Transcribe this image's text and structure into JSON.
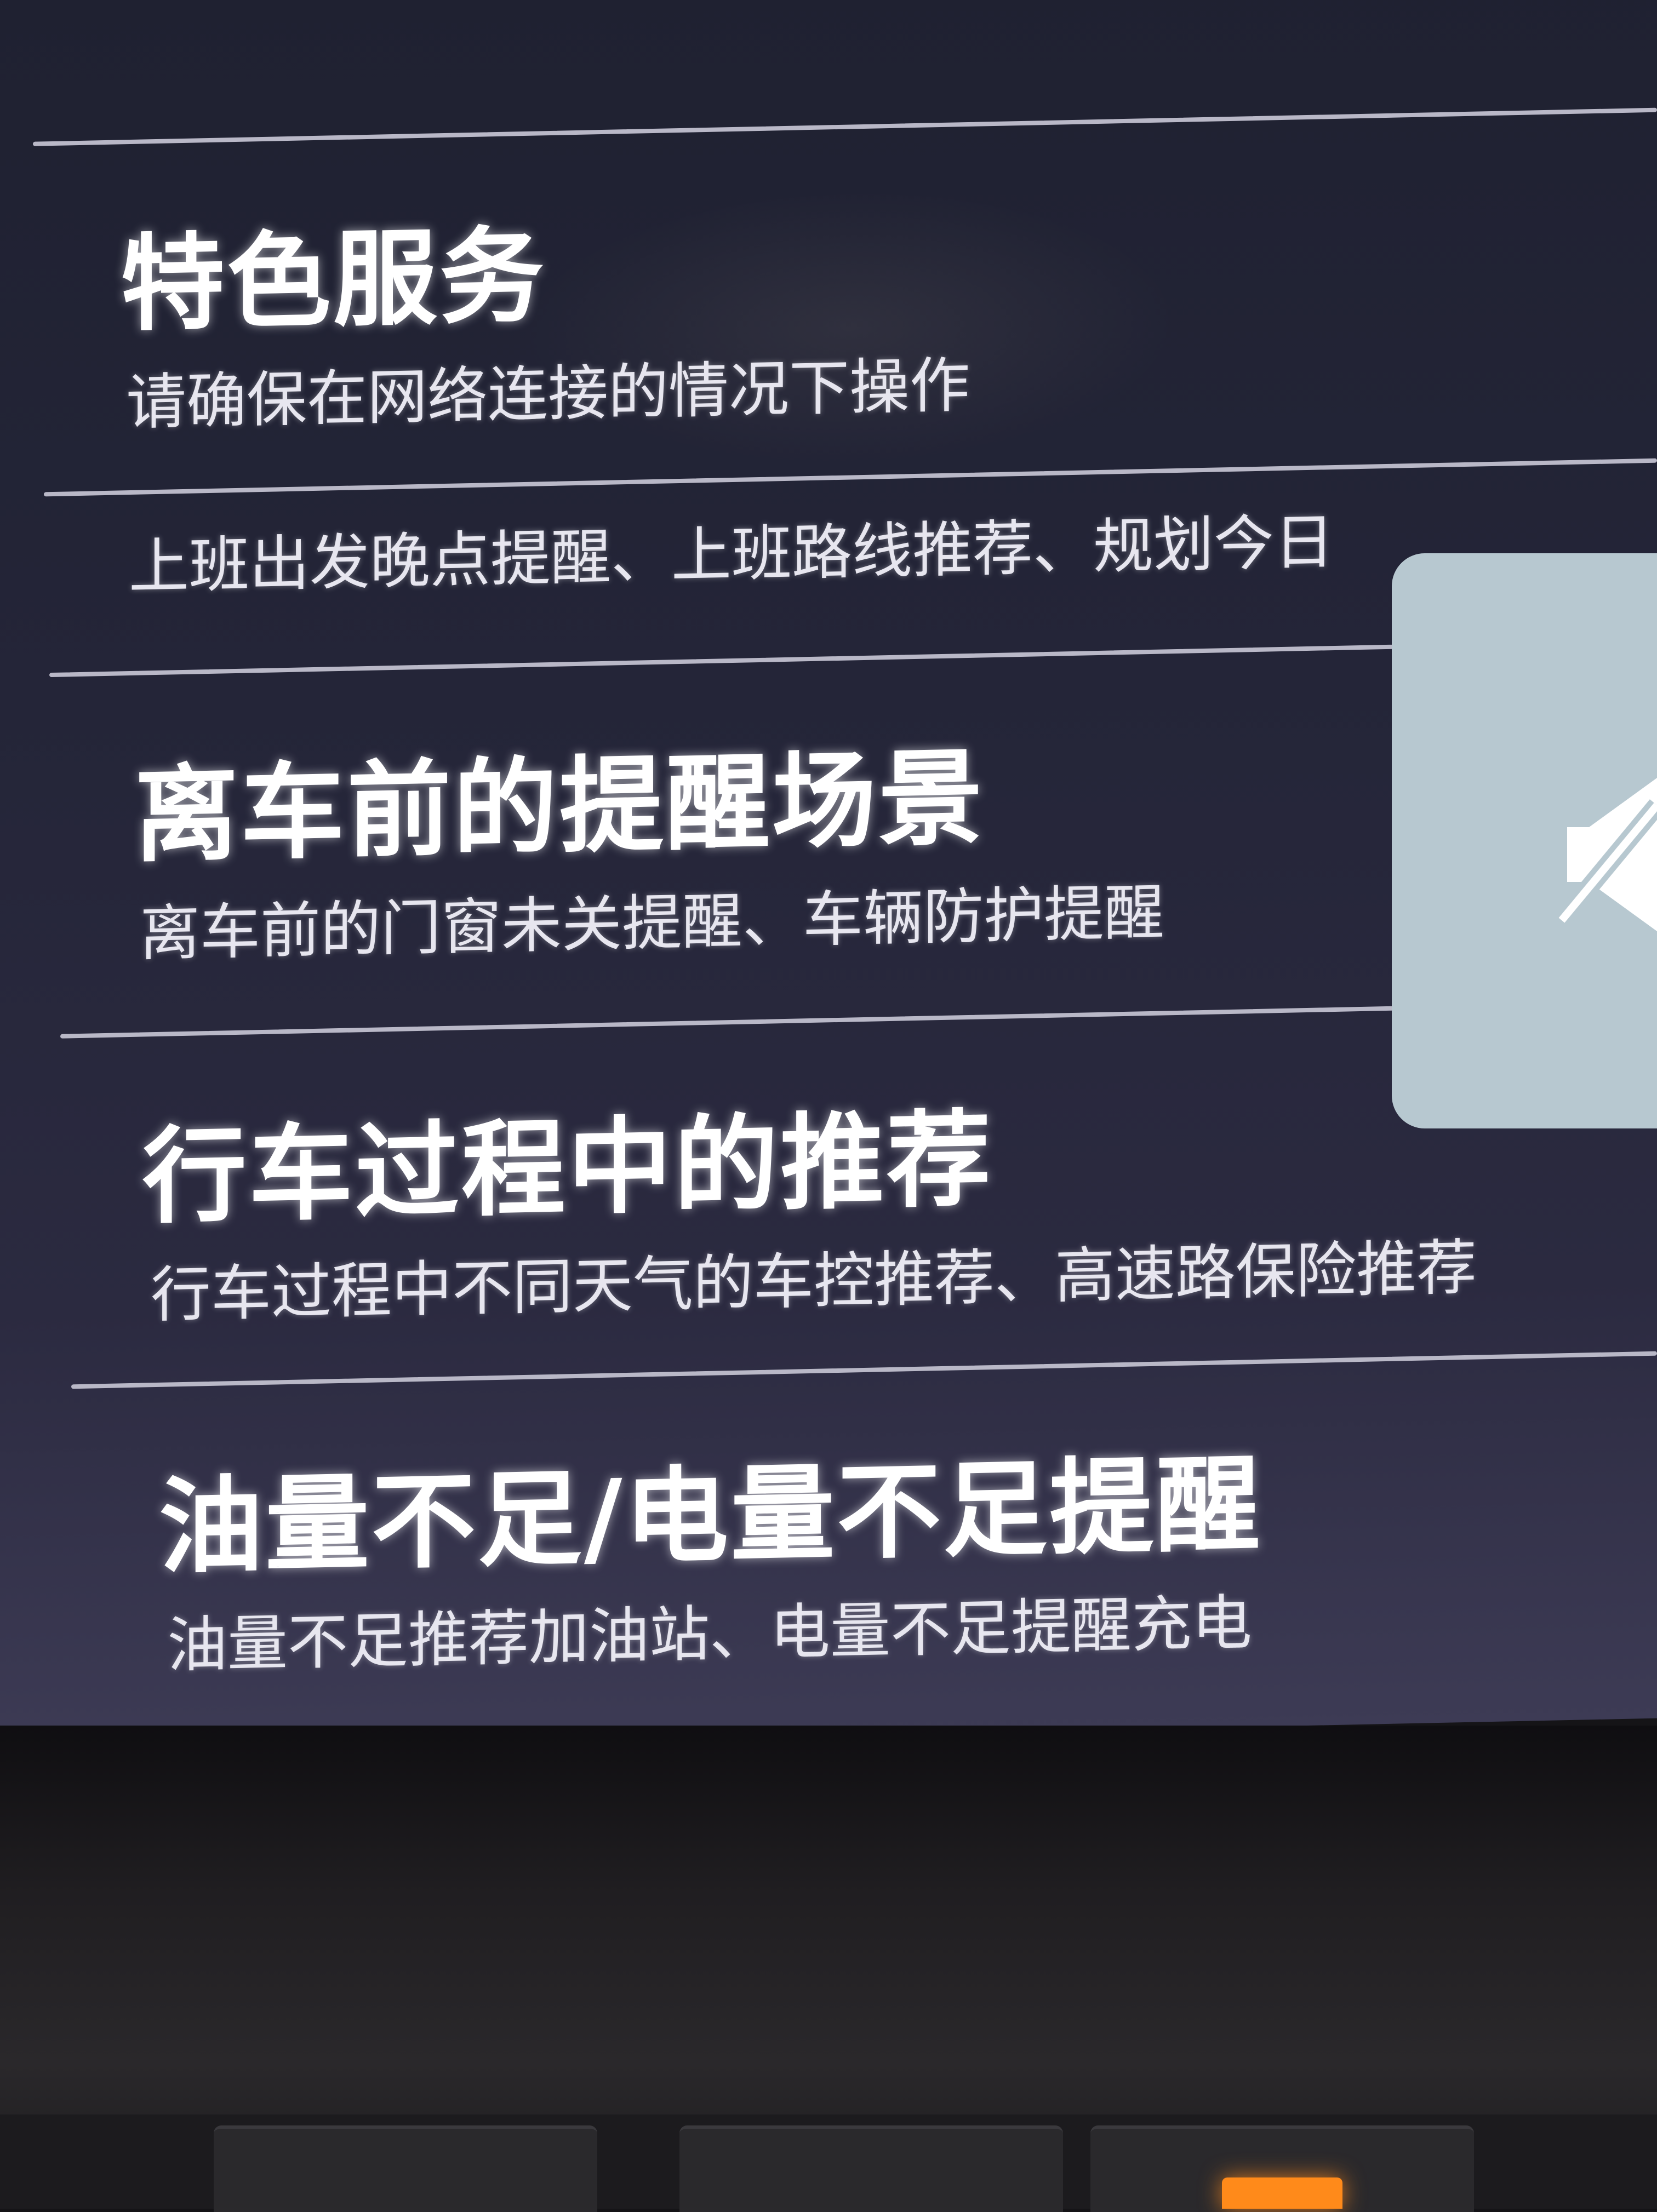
{
  "sections": [
    {
      "title": "特色服务",
      "subtitle": "请确保在网络连接的情况下操作"
    },
    {
      "title": "",
      "subtitle": "上班出发晚点提醒、上班路线推荐、规划今日"
    },
    {
      "title": "离车前的提醒场景",
      "subtitle": "离车前的门窗未关提醒、车辆防护提醒"
    },
    {
      "title": "行车过程中的推荐",
      "subtitle": "行车过程中不同天气的车控推荐、高速路保险推荐"
    },
    {
      "title": "油量不足/电量不足提醒",
      "subtitle": "油量不足推荐加油站、电量不足提醒充电"
    }
  ],
  "overlay": {
    "icon": "mute-icon"
  },
  "colors": {
    "screen": "#242538",
    "text": "#ffffff",
    "divider": "#b9b8c7",
    "popup": "#b7c8d0",
    "indicator": "#ff8a1a"
  }
}
